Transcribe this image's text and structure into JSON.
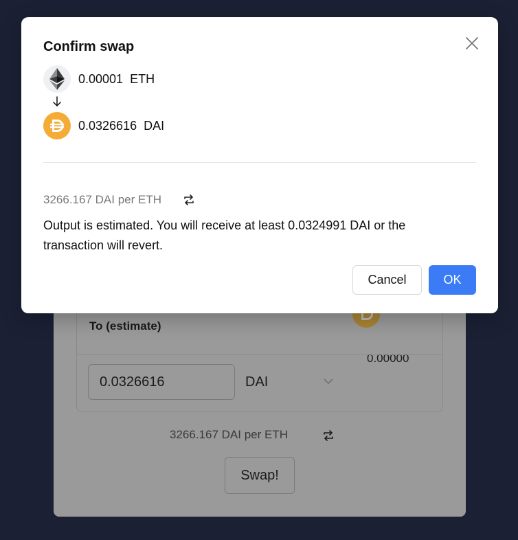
{
  "colors": {
    "backdrop": "#1b2034",
    "primary": "#3b7cf6",
    "dai": "#f5ac37",
    "eth_bg": "#eef0f4"
  },
  "background_card": {
    "to_label": "To (estimate)",
    "to_balance": "0.00000",
    "to_amount_value": "0.0326616",
    "to_token": "DAI",
    "rate_text": "3266.167 DAI per ETH",
    "swap_button_label": "Swap!",
    "icons": [
      "dai-coin-icon",
      "chevron-down-icon",
      "swap-arrows-icon"
    ]
  },
  "modal": {
    "title": "Confirm swap",
    "from": {
      "amount": "0.00001",
      "symbol": "ETH",
      "icon": "eth-icon"
    },
    "to": {
      "amount": "0.0326616",
      "symbol": "DAI",
      "icon": "dai-icon"
    },
    "rate_text": "3266.167 DAI per ETH",
    "output_note": "Output is estimated. You will receive at least 0.0324991 DAI or the transaction will revert.",
    "cancel_label": "Cancel",
    "ok_label": "OK",
    "icons": [
      "close-icon",
      "arrow-down-icon",
      "swap-arrows-icon"
    ]
  }
}
